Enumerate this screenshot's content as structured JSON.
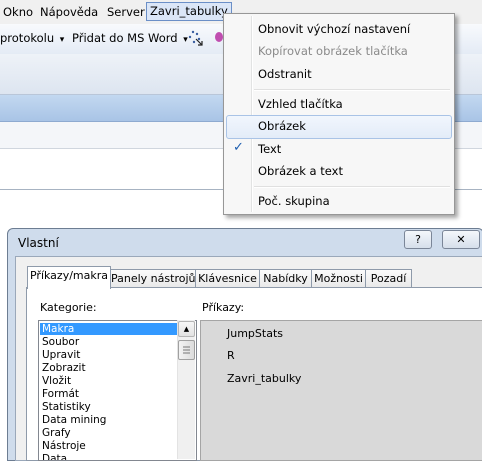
{
  "menubar": {
    "items": [
      "Okno",
      "Nápověda",
      "Server",
      "Zavri_tabulky"
    ]
  },
  "toolbar": {
    "protokolu_label": "protokolu",
    "word_label": "Přidat do MS Word",
    "dropdown_glyph": "▾"
  },
  "context_menu": {
    "items": [
      {
        "label": "Obnovit výchozí nastavení",
        "enabled": true
      },
      {
        "label": "Kopírovat obrázek tlačítka",
        "enabled": false
      },
      {
        "label": "Odstranit",
        "enabled": true
      },
      {
        "label": "Vzhled tlačítka",
        "enabled": true
      },
      {
        "label": "Obrázek",
        "enabled": true,
        "highlighted": true
      },
      {
        "label": "Text",
        "enabled": true,
        "checked": true
      },
      {
        "label": "Obrázek a text",
        "enabled": true
      },
      {
        "label": "Poč. skupina",
        "enabled": true
      }
    ],
    "check_glyph": "✓"
  },
  "dialog": {
    "title": "Vlastní",
    "help_glyph": "?",
    "close_glyph": "✕",
    "tabs": [
      "Příkazy/makra",
      "Panely nástrojů",
      "Klávesnice",
      "Nabídky",
      "Možnosti",
      "Pozadí"
    ],
    "active_tab": "Příkazy/makra",
    "categories_label": "Kategorie:",
    "categories": [
      "Makra",
      "Soubor",
      "Upravit",
      "Zobrazit",
      "Vložit",
      "Formát",
      "Statistiky",
      "Data mining",
      "Grafy",
      "Nástroje",
      "Data"
    ],
    "selected_category": "Makra",
    "commands_label": "Příkazy:",
    "commands": [
      "JumpStats",
      "R",
      "Zavri_tabulky"
    ]
  },
  "colors": {
    "selection": "#3399ff",
    "check": "#1f5fb0",
    "menu_hover_border": "#a9c3e6"
  }
}
